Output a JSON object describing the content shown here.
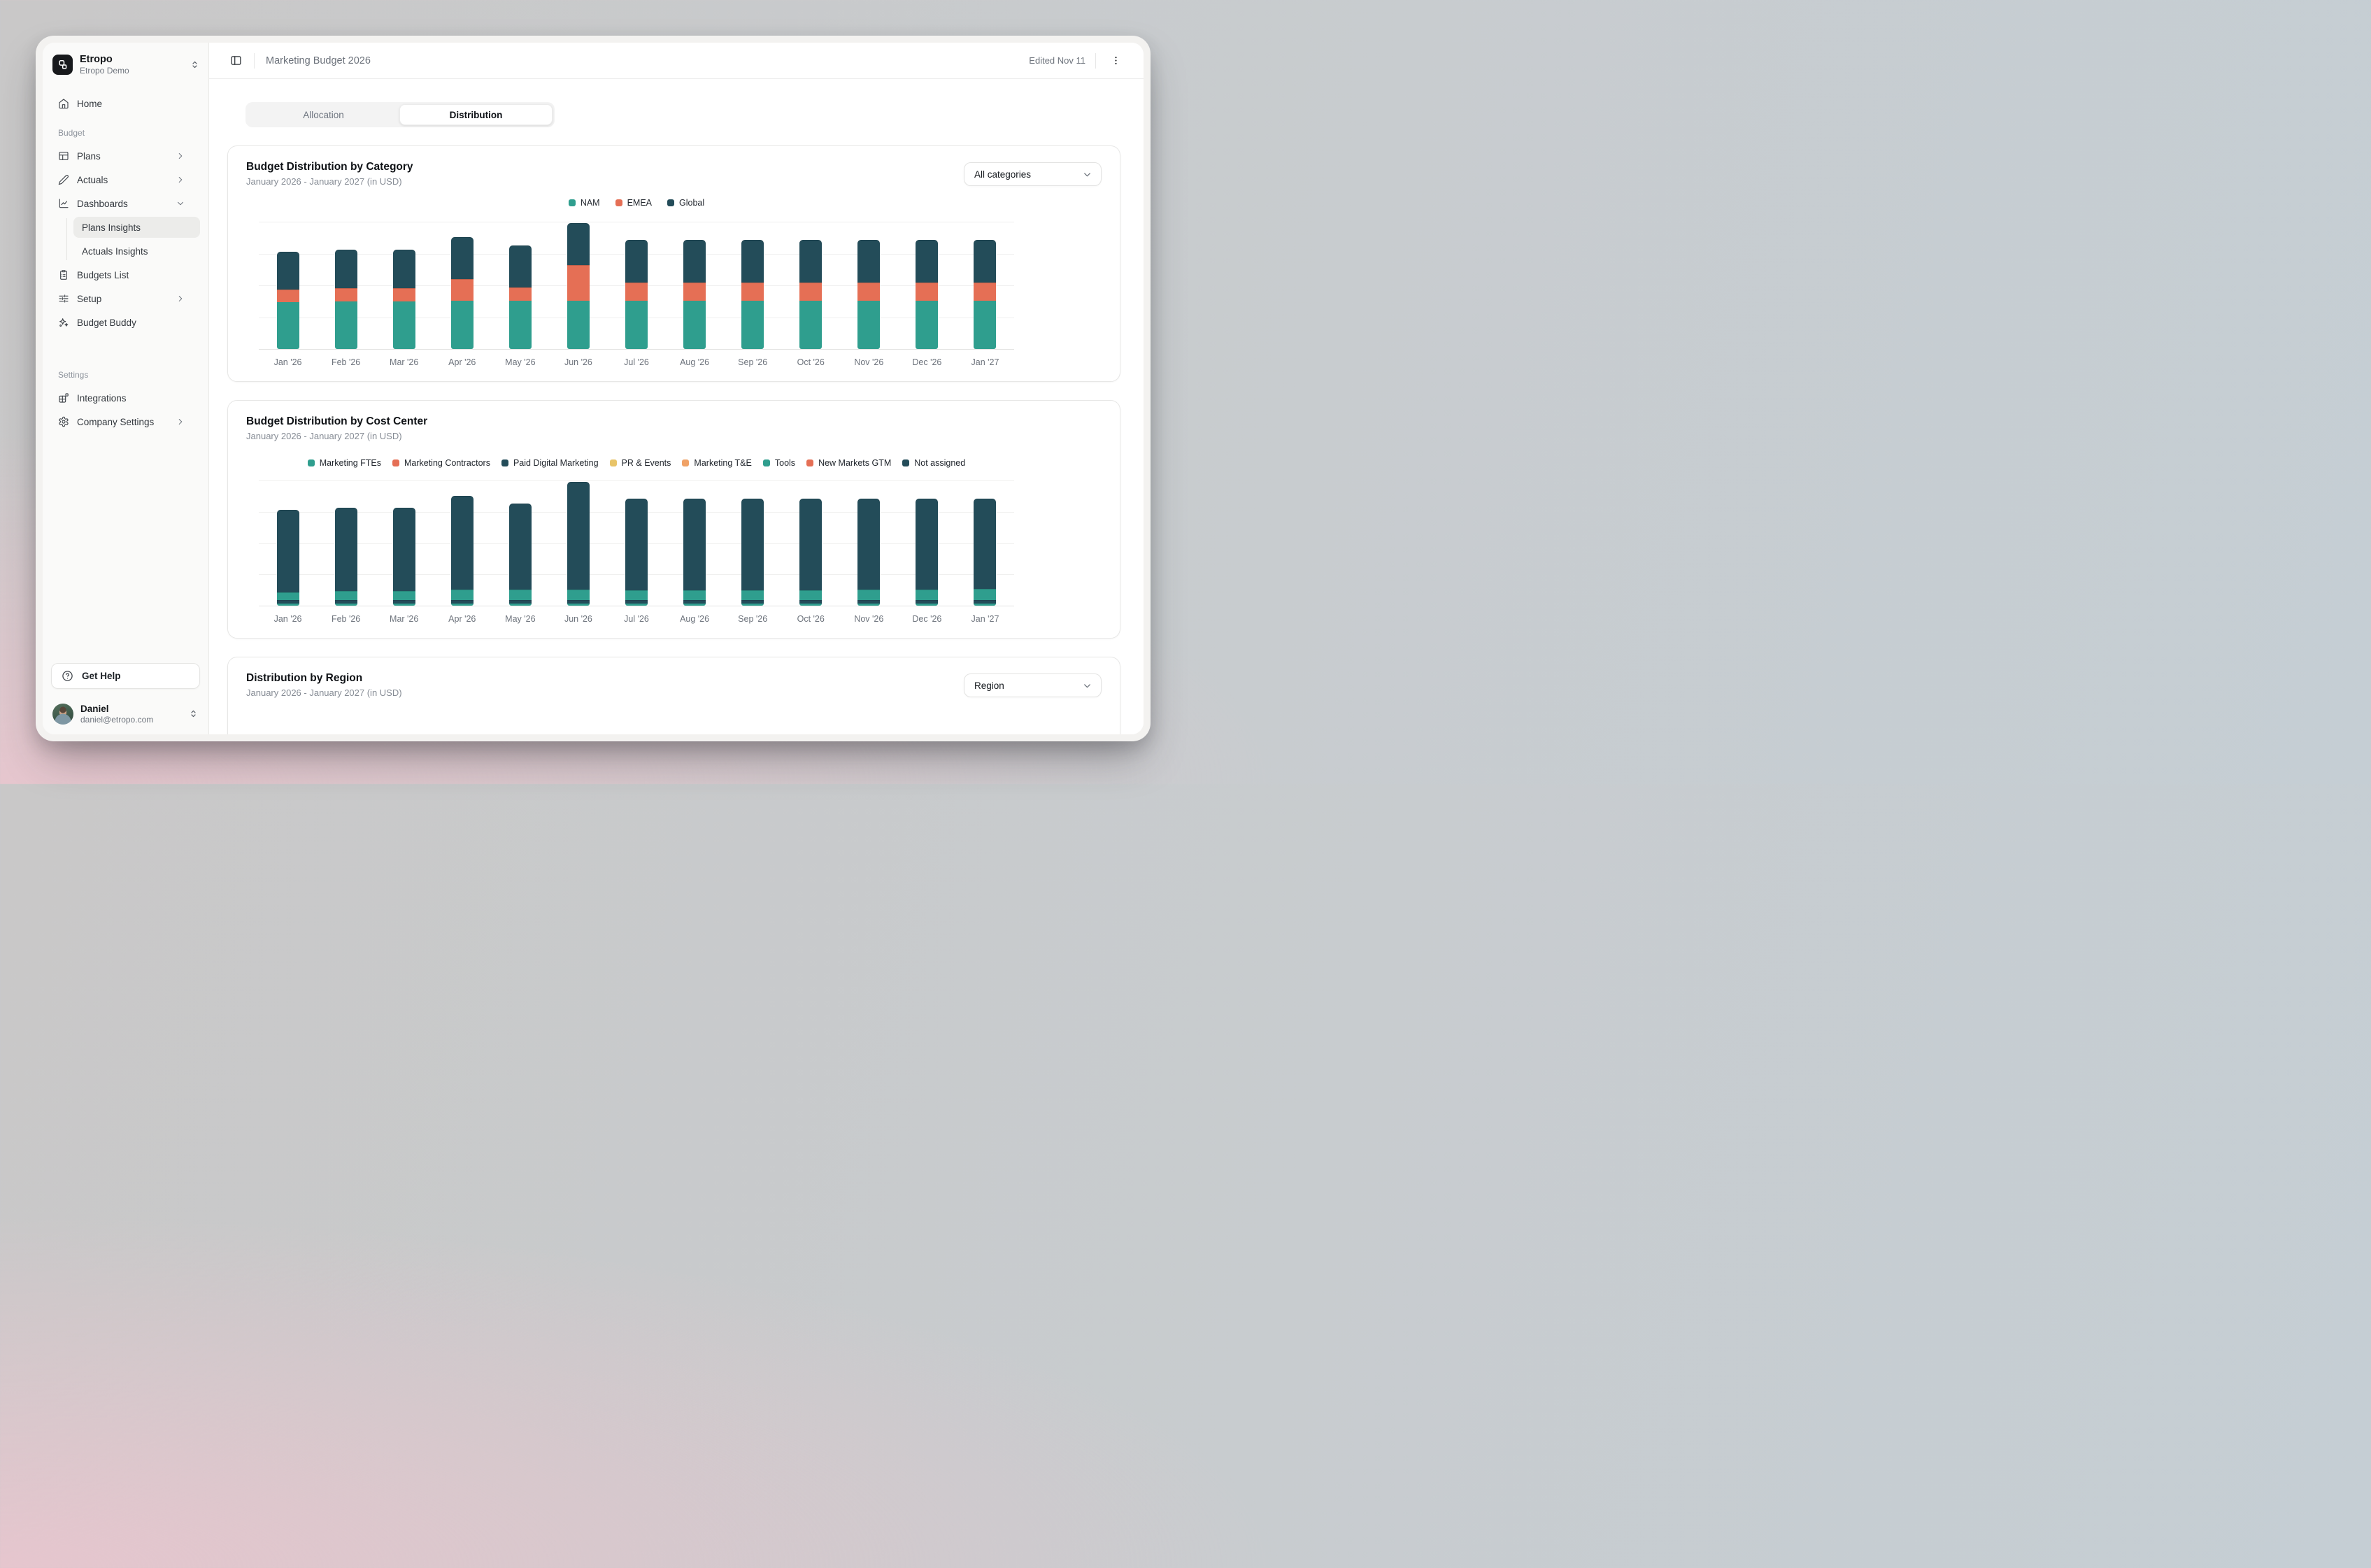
{
  "sidebar": {
    "org": {
      "name": "Etropo",
      "subtitle": "Etropo Demo"
    },
    "sections": [
      {
        "label": "",
        "items": [
          {
            "label": "Home",
            "icon": "home"
          }
        ]
      },
      {
        "label": "Budget",
        "items": [
          {
            "label": "Plans",
            "icon": "table",
            "chevron": "right"
          },
          {
            "label": "Actuals",
            "icon": "pencil",
            "chevron": "right"
          },
          {
            "label": "Dashboards",
            "icon": "chart-line",
            "chevron": "down",
            "children": [
              {
                "label": "Plans Insights",
                "active": true
              },
              {
                "label": "Actuals Insights",
                "active": false
              }
            ]
          },
          {
            "label": "Budgets List",
            "icon": "clipboard-list"
          },
          {
            "label": "Setup",
            "icon": "sliders",
            "chevron": "right"
          },
          {
            "label": "Budget Buddy",
            "icon": "sparkles"
          }
        ]
      },
      {
        "label": "Settings",
        "items": [
          {
            "label": "Integrations",
            "icon": "blocks"
          },
          {
            "label": "Company Settings",
            "icon": "gear",
            "chevron": "right"
          }
        ]
      }
    ],
    "help_button": {
      "label": "Get Help",
      "icon": "circle-help"
    },
    "user": {
      "name": "Daniel",
      "email": "daniel@etropo.com"
    }
  },
  "header": {
    "title": "Marketing Budget 2026",
    "edited": "Edited Nov 11"
  },
  "tabs": [
    {
      "label": "Allocation",
      "active": false
    },
    {
      "label": "Distribution",
      "active": true
    }
  ],
  "colors": {
    "teal": "#2f9e8e",
    "salmon": "#e56f55",
    "dark_slate": "#234c59",
    "gold": "#e8c469",
    "orange": "#f0a266",
    "sidebar_bg": "#fafaf9",
    "selected_item_bg": "#ececea"
  },
  "chart_data": [
    {
      "type": "bar",
      "stacked": true,
      "title": "Budget Distribution by Category",
      "subtitle": "January 2026 - January 2027 (in USD)",
      "filter_label": "All categories",
      "legend_position": "top",
      "grid": true,
      "y_axis": "unlabeled; values are relative units estimated from bar pixel heights",
      "ylim": [
        0,
        365
      ],
      "categories": [
        "Jan '26",
        "Feb '26",
        "Mar '26",
        "Apr '26",
        "May '26",
        "Jun '26",
        "Jul '26",
        "Aug '26",
        "Sep '26",
        "Oct '26",
        "Nov '26",
        "Dec '26",
        "Jan '27"
      ],
      "series": [
        {
          "name": "NAM",
          "color": "#2f9e8e",
          "values": [
            135,
            137,
            137,
            138,
            138,
            138,
            138,
            138,
            138,
            138,
            138,
            138,
            138
          ]
        },
        {
          "name": "EMEA",
          "color": "#e56f55",
          "values": [
            35,
            38,
            38,
            63,
            38,
            102,
            53,
            52,
            52,
            52,
            52,
            52,
            52
          ]
        },
        {
          "name": "Global",
          "color": "#234c59",
          "values": [
            109,
            110,
            110,
            120,
            122,
            122,
            122,
            123,
            123,
            123,
            123,
            123,
            123
          ]
        }
      ]
    },
    {
      "type": "bar",
      "stacked": true,
      "title": "Budget Distribution by Cost Center",
      "subtitle": "January 2026 - January 2027 (in USD)",
      "legend_position": "top",
      "grid": true,
      "y_axis": "unlabeled; values are relative units estimated from bar pixel heights",
      "ylim": [
        0,
        365
      ],
      "categories": [
        "Jan '26",
        "Feb '26",
        "Mar '26",
        "Apr '26",
        "May '26",
        "Jun '26",
        "Jul '26",
        "Aug '26",
        "Sep '26",
        "Oct '26",
        "Nov '26",
        "Dec '26",
        "Jan '27"
      ],
      "series": [
        {
          "name": "Marketing FTEs",
          "color": "#2f9e8e",
          "values": [
            7,
            7,
            7,
            7,
            7,
            7,
            7,
            7,
            7,
            7,
            7,
            7,
            7
          ]
        },
        {
          "name": "Marketing Contractors",
          "color": "#e56f55",
          "values": [
            0,
            0,
            0,
            0,
            0,
            0,
            0,
            0,
            0,
            0,
            0,
            0,
            0
          ]
        },
        {
          "name": "Paid Digital Marketing",
          "color": "#234c59",
          "values": [
            10,
            10,
            10,
            10,
            10,
            10,
            10,
            10,
            10,
            10,
            10,
            10,
            10
          ]
        },
        {
          "name": "PR & Events",
          "color": "#e8c469",
          "values": [
            0,
            0,
            0,
            0,
            0,
            0,
            0,
            0,
            0,
            0,
            0,
            0,
            0
          ]
        },
        {
          "name": "Marketing T&E",
          "color": "#f0a266",
          "values": [
            0,
            0,
            0,
            0,
            0,
            0,
            0,
            0,
            0,
            0,
            0,
            0,
            0
          ]
        },
        {
          "name": "Tools",
          "color": "#2f9e8e",
          "values": [
            22,
            25,
            25,
            30,
            30,
            30,
            28,
            28,
            28,
            28,
            30,
            30,
            33
          ]
        },
        {
          "name": "New Markets GTM",
          "color": "#e56f55",
          "values": [
            0,
            0,
            0,
            0,
            0,
            0,
            0,
            0,
            0,
            0,
            0,
            0,
            0
          ]
        },
        {
          "name": "Not assigned",
          "color": "#234c59",
          "values": [
            240,
            243,
            243,
            274,
            251,
            315,
            268,
            268,
            268,
            268,
            266,
            266,
            263
          ]
        }
      ]
    },
    {
      "type": "bar",
      "title": "Distribution by Region",
      "subtitle": "January 2026 - January 2027 (in USD)",
      "filter_label": "Region",
      "note": "chart body is cut off below the visible viewport"
    }
  ]
}
